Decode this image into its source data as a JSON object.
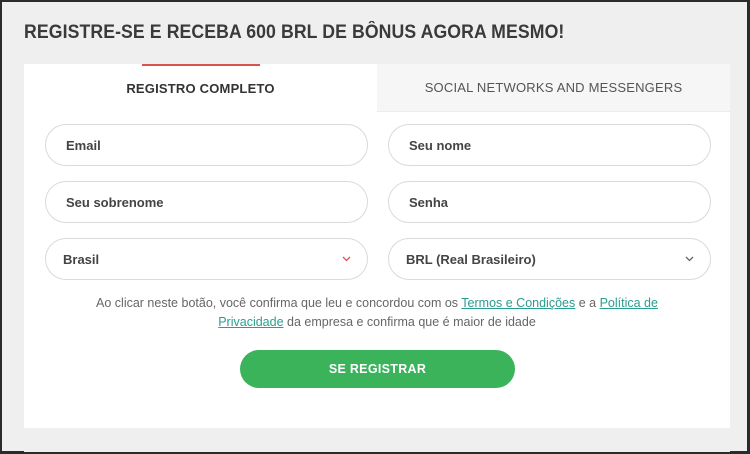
{
  "header": {
    "title": "REGISTRE-SE E RECEBA 600 BRL DE BÔNUS AGORA MESMO!"
  },
  "tabs": [
    {
      "label": "REGISTRO COMPLETO",
      "active": true
    },
    {
      "label": "SOCIAL NETWORKS AND MESSENGERS",
      "active": false
    }
  ],
  "form": {
    "email_placeholder": "Email",
    "first_name_placeholder": "Seu nome",
    "last_name_placeholder": "Seu sobrenome",
    "password_placeholder": "Senha",
    "country_value": "Brasil",
    "currency_value": "BRL (Real Brasileiro)"
  },
  "terms": {
    "part1": "Ao clicar neste botão, você confirma que leu e concordou com os ",
    "link_terms": "Termos e Condições",
    "part2": " e a ",
    "link_privacy": "Política de Privacidade",
    "part3": " da empresa e confirma que é maior de idade"
  },
  "submit_label": "SE REGISTRAR",
  "colors": {
    "accent_red": "#d9534f",
    "button_green": "#3ab35a",
    "link_teal": "#2a9d8f",
    "chevron_country": "#d9534f",
    "chevron_currency": "#666666"
  }
}
